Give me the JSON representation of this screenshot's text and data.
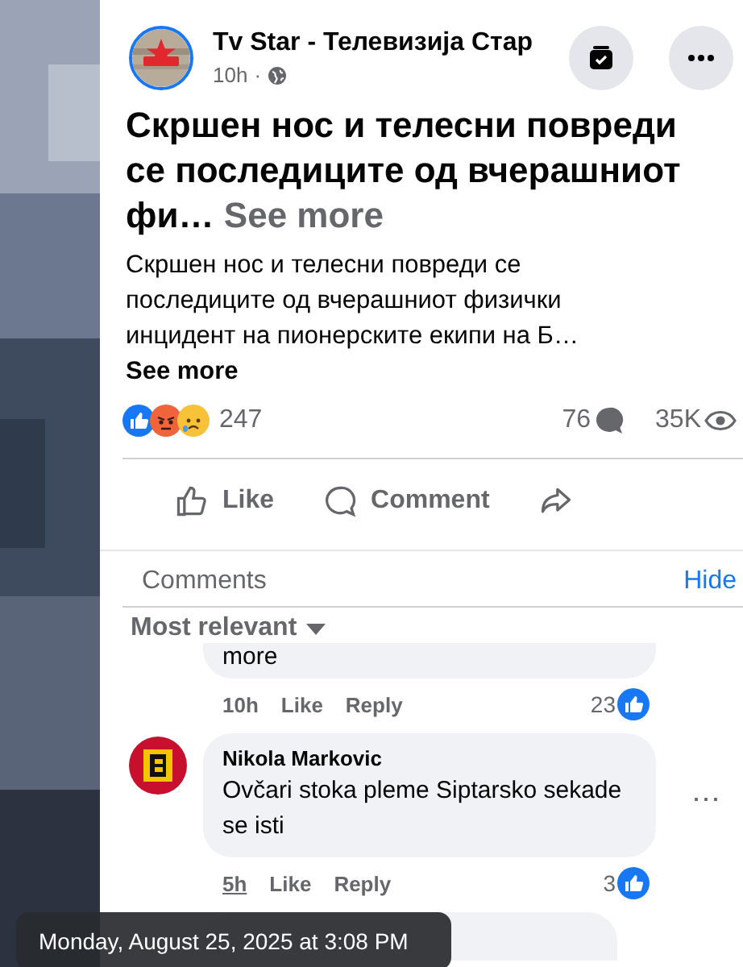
{
  "post": {
    "author": "Tv Star - Телевизија Стар",
    "time": "10h",
    "separator": "·",
    "headline": "Скршен нос и телесни повреди се последиците од вчерашниот фи…",
    "headline_more": "See more",
    "body": "Скршен нос и телесни повреди се последиците од вчерашниот физички инцидент на пионерските екипи на Б…",
    "body_more": "See more",
    "reaction_count": "247",
    "comment_count": "76",
    "view_count": "35K",
    "actions": [
      {
        "kind": "like",
        "label": "Like"
      },
      {
        "kind": "comment",
        "label": "Comment"
      },
      {
        "kind": "share"
      }
    ]
  },
  "comments_section": {
    "title": "Comments",
    "hide": "Hide",
    "sort": "Most relevant",
    "comments": [
      {
        "kind": "cut_top",
        "text": "more",
        "time": "10h",
        "like": "Like",
        "reply": "Reply",
        "likes": "23"
      },
      {
        "kind": "full",
        "author": "Nikola Markovic",
        "text": "Ovčari stoka pleme Siptarsko sekade se isti",
        "time": "5h",
        "like": "Like",
        "reply": "Reply",
        "likes": "3",
        "more": "⋯"
      },
      {
        "kind": "cut_bottom"
      }
    ]
  },
  "tooltip": "Monday, August 25, 2025 at 3:08 PM"
}
